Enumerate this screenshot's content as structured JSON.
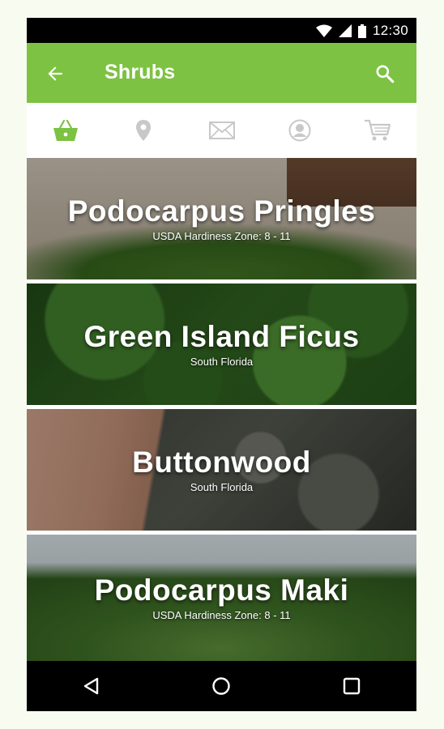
{
  "status_bar": {
    "time": "12:30"
  },
  "app_bar": {
    "title": "Shrubs"
  },
  "tabs": [
    {
      "icon": "basket-icon",
      "active": true
    },
    {
      "icon": "location-pin-icon",
      "active": false
    },
    {
      "icon": "mail-icon",
      "active": false
    },
    {
      "icon": "profile-icon",
      "active": false
    },
    {
      "icon": "cart-icon",
      "active": false
    }
  ],
  "plants": [
    {
      "name": "Podocarpus Pringles",
      "subtitle": "USDA Hardiness Zone:  8 - 11"
    },
    {
      "name": "Green Island Ficus",
      "subtitle": "South Florida"
    },
    {
      "name": "Buttonwood",
      "subtitle": "South Florida"
    },
    {
      "name": "Podocarpus Maki",
      "subtitle": "USDA Hardiness Zone:  8 - 11"
    }
  ],
  "colors": {
    "accent": "#7dc242",
    "tab_inactive": "#c8c8c8"
  }
}
